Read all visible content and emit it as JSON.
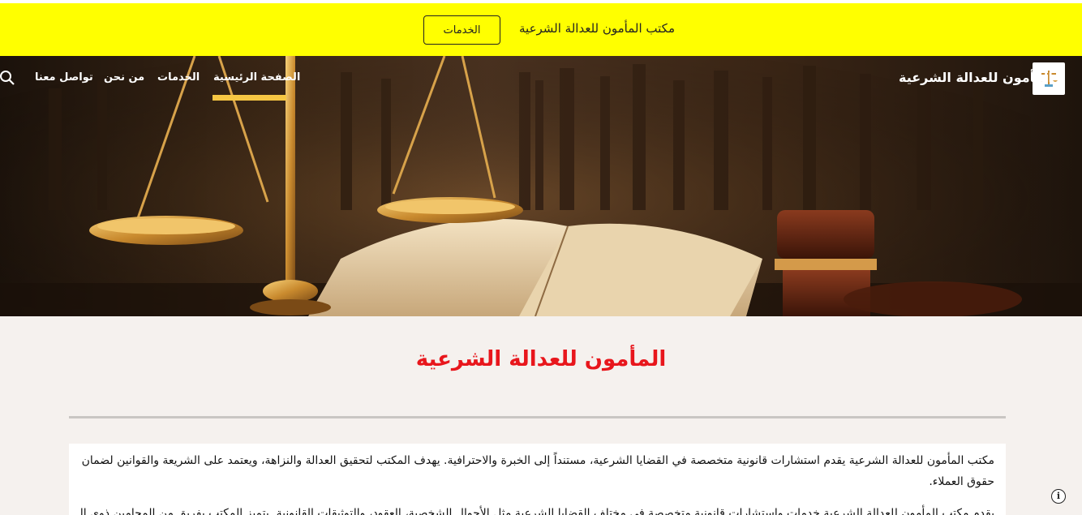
{
  "announcement": {
    "text": "مكتب المأمون للعدالة الشرعية",
    "button_label": "الخدمات"
  },
  "header": {
    "site_name": "المأمون للعدالة الشرعية",
    "logo_icon": "scales-of-justice-logo",
    "nav": [
      {
        "label": "الصفحة الرئيسية",
        "active": true
      },
      {
        "label": "الخدمات"
      },
      {
        "label": "من نحن"
      },
      {
        "label": "تواصل معنا"
      }
    ],
    "search_icon": "search-icon",
    "accent_color": "#f6c643"
  },
  "hero": {
    "image": "scales-of-justice-gavel-and-open-book"
  },
  "main": {
    "title": "المأمون للعدالة الشرعية",
    "title_color": "#e8161c",
    "paragraphs": [
      "مكتب المأمون للعدالة  الشرعية يقدم استشارات قانونية متخصصة في القضايا الشرعية، مستنداً إلى الخبرة والاحترافية. يهدف المكتب لتحقيق العدالة والنزاهة، ويعتمد على الشريعة والقوانين لضمان حقوق العملاء.",
      "يقدم مكتب المأمون للعدالة الشرعية خدمات واستشارات قانونية متخصصة في مختلف القضايا الشرعية مثل الأحوال الشخصية، العقود، والتوثيقات القانونية. يتميز المكتب بفريق من المحامين ذوي الخبرة"
    ]
  },
  "colors": {
    "banner": "#ffff00",
    "page_background": "#f5f1ee"
  },
  "info_icon": "info-icon"
}
